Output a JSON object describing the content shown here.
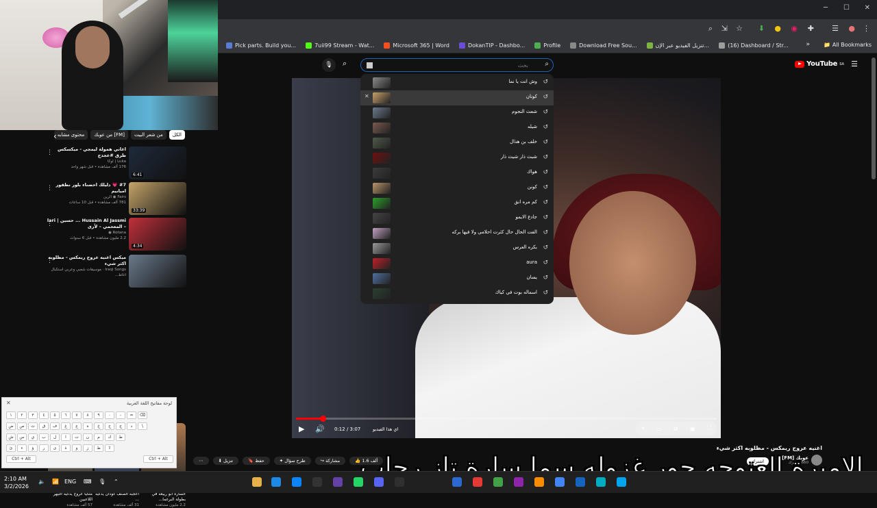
{
  "browser": {
    "bookmarks": [
      {
        "label": "Pick parts. Build you...",
        "icon": "pcpartpicker-icon",
        "color": "#5a7bd6"
      },
      {
        "label": "7uii99 Stream - Wat...",
        "icon": "kick-icon",
        "color": "#53fc18"
      },
      {
        "label": "Microsoft 365 | Word",
        "icon": "microsoft-icon",
        "color": "#f25022"
      },
      {
        "label": "DokanTIP - Dashbo...",
        "icon": "dokantip-icon",
        "color": "#6c4bd6"
      },
      {
        "label": "Profile",
        "icon": "profile-icon",
        "color": "#4caf50"
      },
      {
        "label": "Download Free Sou...",
        "icon": "download-icon",
        "color": "#888888"
      },
      {
        "label": "تنزيل الفيديو عبر الإن...",
        "icon": "download-arrow-icon",
        "color": "#7cb342"
      },
      {
        "label": "(16) Dashboard / Str...",
        "icon": "dashboard-icon",
        "color": "#9e9e9e"
      }
    ],
    "all_bookmarks": "All Bookmarks"
  },
  "youtube": {
    "logo": "YouTube",
    "logo_region": "SA",
    "search": {
      "placeholder": "بحث",
      "value": ""
    },
    "suggestions": [
      {
        "text": "وش انت يا نما",
        "thumb": "#8a8a8a"
      },
      {
        "text": "كونان",
        "thumb": "#c9a06a",
        "highlighted": true
      },
      {
        "text": "شعث النجوم",
        "thumb": "#6c7a8c"
      },
      {
        "text": "شيله",
        "thumb": "#7a5a50"
      },
      {
        "text": "خلف بن هذال",
        "thumb": "#4e5a48"
      },
      {
        "text": "شبث ذار شيث ذار",
        "thumb": "#701010"
      },
      {
        "text": "هواك",
        "thumb": "#3c3c3c"
      },
      {
        "text": "كونن",
        "thumb": "#b8946a"
      },
      {
        "text": "كم مره انق",
        "thumb": "#2aa02a"
      },
      {
        "text": "جادع الايمو",
        "thumb": "#444444"
      },
      {
        "text": "الفت الحال حال كثرت احلامي ولا فيها بركه",
        "thumb": "#c0a0c0"
      },
      {
        "text": "بكره العرس",
        "thumb": "#999999"
      },
      {
        "text": "aura",
        "thumb": "#c0202a"
      },
      {
        "text": "يسان",
        "thumb": "#5070a0"
      },
      {
        "text": "اسماله بوت في كياك",
        "thumb": "#2a4030"
      }
    ],
    "player": {
      "time": "0:12 / 3:07",
      "chapter": "اي هذا الفيديو",
      "progress": 0.064
    },
    "video": {
      "title": "اغنيه عروج ريمكس - مظلوبه اكثر شيء",
      "channel": "عوبك [FM]",
      "subscribers": "660 مشترك",
      "subscribe": "اشترك",
      "likes": "1.6 ألف",
      "share": "مشاركة",
      "download": "تنزيل",
      "save": "حفظ",
      "ask": "طرح سؤال"
    },
    "chips": [
      "الكل",
      "من شعر البيت",
      "من عوبك [FM]",
      "محتوى مشابه"
    ],
    "related": [
      {
        "title": "اغاني همولة ليمجي - ميكسكس طرق #عجدج",
        "meta": "Luka | لوكا",
        "meta2": "176 ألف مشاهدة • قبل شهر واحد",
        "duration": "6:41",
        "thumb": "#1e2a3a"
      },
      {
        "title": "#7 💗 دليلك احضناء بلور نظقور اميانيم",
        "meta": "Fairs ◉ الرين",
        "meta2": "781 ألف مشاهدة • قبل 10 ساعات",
        "duration": "33:39",
        "thumb": "#c4a46a"
      },
      {
        "title": "Hussain Al Jassmi ... حسين | lari – المعحمي – لأرى",
        "meta": "Rotana ◉",
        "meta2": "2.2 مليون مشاهدة • قبل 6 سنوات",
        "duration": "4:34",
        "thumb": "#c0303a"
      },
      {
        "title": "ميكس اغنيه عروج ريمكس - مظلوبه اكثر شيء",
        "meta": "Iraqi Songs · موسيقات شعبي وعربي استكبال اغاط...",
        "meta2": "",
        "duration": "",
        "thumb": "#6a7a8a"
      }
    ],
    "shorts": [
      {
        "title": "خساره ابو رييعه في بطولة البرغما...",
        "meta": "2.2 مليون مشاهدة",
        "color": "#b07a50"
      },
      {
        "title": "اعجبه الصنف كودان يذكيه ...",
        "meta": "31 ألف مشاهدة",
        "color": "#6a90d0"
      },
      {
        "title": "متكيا عروج يذكيه آلتيهر اللاعبين",
        "meta": "57 ألف مشاهدة",
        "color": "#d0c0a0"
      }
    ]
  },
  "keyboard": {
    "title": "لوحة مفاتيح اللغة العربية",
    "rows": [
      [
        "١",
        "٢",
        "٣",
        "٤",
        "٥",
        "٦",
        "٧",
        "٨",
        "٩",
        "٠",
        "-",
        "=",
        "⌫"
      ],
      [
        "ض",
        "ص",
        "ث",
        "ق",
        "ف",
        "غ",
        "ع",
        "ه",
        "خ",
        "ح",
        "ج",
        "د",
        "\\"
      ],
      [
        "ش",
        "س",
        "ي",
        "ب",
        "ل",
        "ا",
        "ت",
        "ن",
        "م",
        "ك",
        "ط"
      ],
      [
        "ئ",
        "ء",
        "ؤ",
        "ر",
        "ى",
        "ة",
        "و",
        "ز",
        "ظ",
        "⇧"
      ],
      [
        "Ctrl + Alt",
        "Ctrl + Alt"
      ]
    ]
  },
  "caption": "الاميرة العنوجه حور غزوله سما سارة تاز رحاب",
  "taskbar": {
    "time": "2:10 AM",
    "date": "3/2/2026",
    "lang": "ENG"
  }
}
